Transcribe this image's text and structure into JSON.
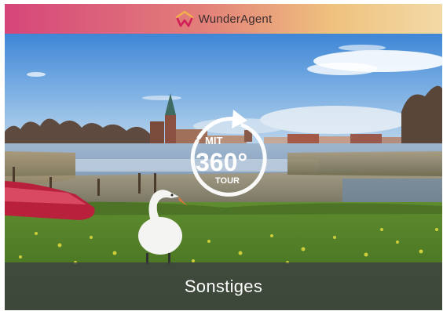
{
  "header": {
    "brand": "WunderAgent",
    "logo_icon": "house-w-logo-icon",
    "gradient": [
      "#d6457a",
      "#efc27e"
    ]
  },
  "badge": {
    "top_text": "MIT",
    "degrees": "360°",
    "bottom_text": "TOUR",
    "icon": "rotate-arrow-icon"
  },
  "footer": {
    "label": "Sonstiges"
  },
  "photo": {
    "icon": "swan-lake-photo"
  }
}
